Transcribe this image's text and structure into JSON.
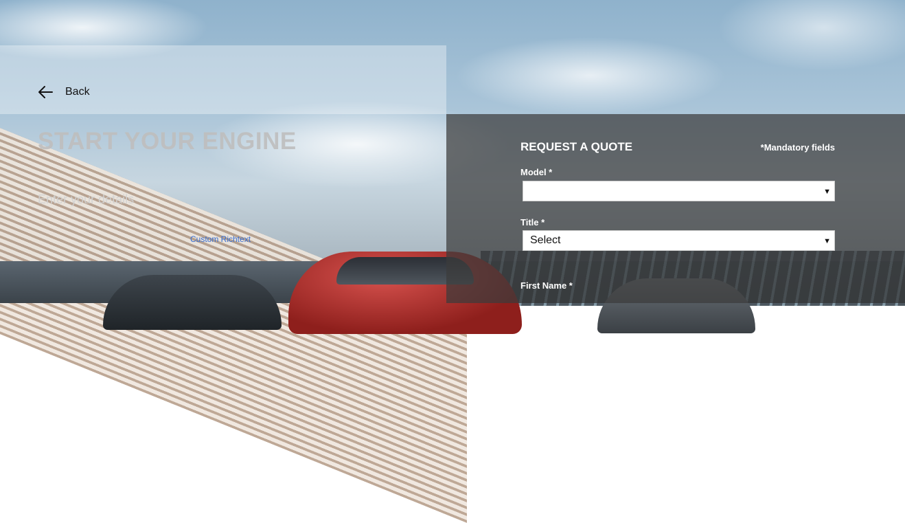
{
  "header": {
    "back_label": "Back"
  },
  "hero": {
    "title": "START YOUR ENGINE",
    "subtitle": "Enter your details",
    "custom_richtext": "Custom Richtext"
  },
  "form": {
    "title": "REQUEST A QUOTE",
    "mandatory_note": "*Mandatory fields",
    "fields": [
      {
        "label": "Model *",
        "value": ""
      },
      {
        "label": "Title *",
        "value": "Select"
      },
      {
        "label": "First Name *"
      }
    ]
  },
  "icons": {
    "back": "arrow-left-icon",
    "select_caret": "caret-down-icon"
  },
  "colors": {
    "form_panel": "#3c3c3c",
    "link_blue": "#3a6fd1"
  }
}
